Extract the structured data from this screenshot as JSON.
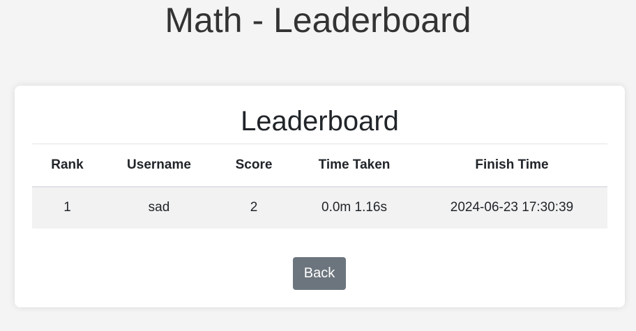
{
  "page": {
    "title": "Math - Leaderboard"
  },
  "card": {
    "title": "Leaderboard"
  },
  "table": {
    "headers": [
      "Rank",
      "Username",
      "Score",
      "Time Taken",
      "Finish Time"
    ],
    "rows": [
      [
        "1",
        "sad",
        "2",
        "0.0m 1.16s",
        "2024-06-23 17:30:39"
      ]
    ]
  },
  "actions": {
    "back_label": "Back"
  },
  "colors": {
    "background": "#f4f4f4",
    "card": "#ffffff",
    "row_stripe": "#f2f2f2",
    "button": "#6c757d",
    "text": "#212529"
  }
}
